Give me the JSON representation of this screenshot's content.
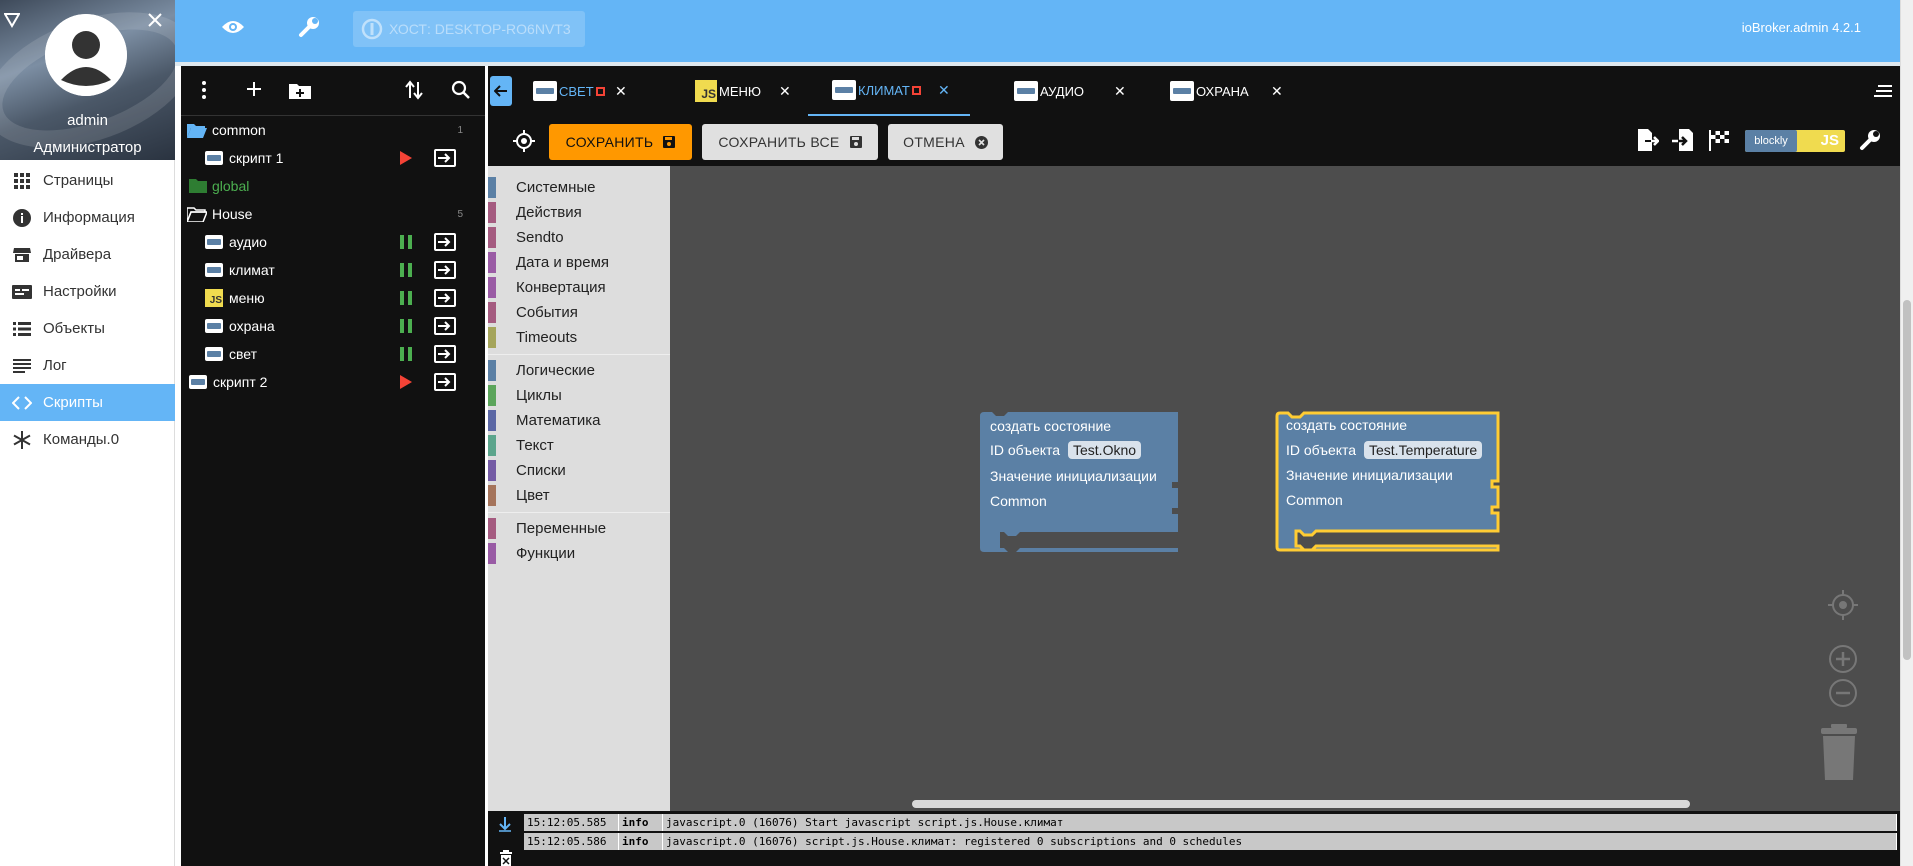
{
  "user": {
    "name": "admin",
    "role": "Администратор"
  },
  "nav": [
    {
      "label": "Страницы",
      "icon": "grid-icon"
    },
    {
      "label": "Информация",
      "icon": "info-icon"
    },
    {
      "label": "Драйвера",
      "icon": "store-icon"
    },
    {
      "label": "Настройки",
      "icon": "settings-list-icon"
    },
    {
      "label": "Объекты",
      "icon": "list-icon"
    },
    {
      "label": "Лог",
      "icon": "log-icon"
    },
    {
      "label": "Скрипты",
      "icon": "code-icon",
      "active": true
    },
    {
      "label": "Команды.0",
      "icon": "snowflake-icon"
    }
  ],
  "topbar": {
    "host": "ХОСТ: DESKTOP-RO6NVT3",
    "version": "ioBroker.admin 4.2.1"
  },
  "tree": [
    {
      "type": "folder",
      "label": "common",
      "count": "1",
      "open": true
    },
    {
      "type": "script",
      "label": "скрипт 1",
      "kind": "blockly",
      "state": "stopped"
    },
    {
      "type": "folder",
      "label": "global",
      "count": "",
      "open": false,
      "color": "#4caf50"
    },
    {
      "type": "folder",
      "label": "House",
      "count": "5",
      "open": true
    },
    {
      "type": "script",
      "label": "аудио",
      "kind": "blockly",
      "state": "running"
    },
    {
      "type": "script",
      "label": "климат",
      "kind": "blockly",
      "state": "running"
    },
    {
      "type": "script",
      "label": "меню",
      "kind": "js",
      "state": "running"
    },
    {
      "type": "script",
      "label": "охрана",
      "kind": "blockly",
      "state": "running"
    },
    {
      "type": "script",
      "label": "свет",
      "kind": "blockly",
      "state": "running"
    },
    {
      "type": "script",
      "label": "скрипт 2",
      "kind": "blockly",
      "state": "stopped",
      "root": true
    }
  ],
  "tabs": [
    {
      "label": "СВЕТ",
      "kind": "blockly",
      "modified": true
    },
    {
      "label": "МЕНЮ",
      "kind": "js"
    },
    {
      "label": "КЛИМАТ",
      "kind": "blockly",
      "modified": true,
      "active": true
    },
    {
      "label": "АУДИО",
      "kind": "blockly"
    },
    {
      "label": "ОХРАНА",
      "kind": "blockly"
    }
  ],
  "actions": {
    "save": "СОХРАНИТЬ",
    "save_all": "СОХРАНИТЬ ВСЕ",
    "cancel": "ОТМЕНА",
    "blockly_toggle": "blockly",
    "js_toggle": "JS"
  },
  "toolbox": [
    {
      "label": "Системные",
      "color": "#5b80a5"
    },
    {
      "label": "Действия",
      "color": "#a55b80"
    },
    {
      "label": "Sendto",
      "color": "#a55b80"
    },
    {
      "label": "Дата и время",
      "color": "#9a5ba5"
    },
    {
      "label": "Конвертация",
      "color": "#9a5ba5"
    },
    {
      "label": "События",
      "color": "#a55b80"
    },
    {
      "label": "Timeouts",
      "color": "#a5a55b"
    },
    {
      "label": "Логические",
      "color": "#5b80a5",
      "sep": true
    },
    {
      "label": "Циклы",
      "color": "#5ba55b"
    },
    {
      "label": "Математика",
      "color": "#5b67a5"
    },
    {
      "label": "Текст",
      "color": "#5ba58c"
    },
    {
      "label": "Списки",
      "color": "#745ba5"
    },
    {
      "label": "Цвет",
      "color": "#a5745b"
    },
    {
      "label": "Переменные",
      "color": "#a55b80",
      "sep": true
    },
    {
      "label": "Функции",
      "color": "#995ba5"
    }
  ],
  "blocks": [
    {
      "title": "создать состояние",
      "id_label": "ID объекта",
      "id_value": "Test.Okno",
      "init_label": "Значение инициализации",
      "common_label": "Common",
      "selected": false
    },
    {
      "title": "создать состояние",
      "id_label": "ID объекта",
      "id_value": "Test.Temperature",
      "init_label": "Значение инициализации",
      "common_label": "Common",
      "selected": true
    }
  ],
  "log": [
    {
      "time": "15:12:05.585",
      "level": "info",
      "message": "javascript.0 (16076) Start javascript script.js.House.климат"
    },
    {
      "time": "15:12:05.586",
      "level": "info",
      "message": "javascript.0 (16076) script.js.House.климат: registered 0 subscriptions and 0 schedules"
    }
  ]
}
